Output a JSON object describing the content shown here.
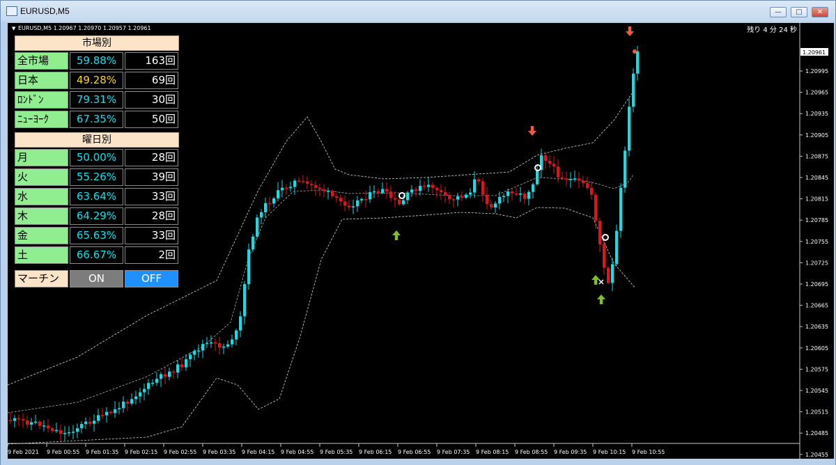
{
  "window": {
    "title": "EURUSD,M5"
  },
  "chart": {
    "info": "EURUSD,M5  1.20967 1.20970 1.20957 1.20961",
    "remaining": "残り 4 分 24 秒",
    "current_price": "1.20961",
    "price_labels": [
      "1.20995",
      "1.20965",
      "1.20935",
      "1.20905",
      "1.20875",
      "1.20845",
      "1.20815",
      "1.20785",
      "1.20755",
      "1.20725",
      "1.20695",
      "1.20665",
      "1.20635",
      "1.20605",
      "1.20575",
      "1.20545",
      "1.20515",
      "1.20485",
      "1.20455"
    ],
    "time_labels": [
      "9 Feb 2021",
      "9 Feb 00:55",
      "9 Feb 01:35",
      "9 Feb 02:15",
      "9 Feb 02:55",
      "9 Feb 03:35",
      "9 Feb 04:15",
      "9 Feb 04:55",
      "9 Feb 05:35",
      "9 Feb 06:15",
      "9 Feb 06:55",
      "9 Feb 07:35",
      "9 Feb 08:15",
      "9 Feb 08:55",
      "9 Feb 09:35",
      "9 Feb 10:15",
      "9 Feb 10:55"
    ],
    "colors": {
      "up": "#00e5ee",
      "down": "#e8101a",
      "band": "#ffffff",
      "arrow_up": "#7fbf2a",
      "arrow_down": "#f05a46",
      "background": "#000000"
    }
  },
  "panel": {
    "market_header": "市場別",
    "market_rows": [
      {
        "name": "全市場",
        "pct": "59.88%",
        "count": "163回",
        "color": "#00e5ee"
      },
      {
        "name": "日本",
        "pct": "49.28%",
        "count": "69回",
        "color": "#ffd700"
      },
      {
        "name": "ﾛﾝﾄﾞﾝ",
        "pct": "79.31%",
        "count": "30回",
        "color": "#00e5ee"
      },
      {
        "name": "ﾆｭｰﾖｰｸ",
        "pct": "67.35%",
        "count": "50回",
        "color": "#00e5ee"
      }
    ],
    "weekday_header": "曜日別",
    "weekday_rows": [
      {
        "name": "月",
        "pct": "50.00%",
        "count": "28回",
        "color": "#00e5ee"
      },
      {
        "name": "火",
        "pct": "55.26%",
        "count": "39回",
        "color": "#00e5ee"
      },
      {
        "name": "水",
        "pct": "63.64%",
        "count": "33回",
        "color": "#00e5ee"
      },
      {
        "name": "木",
        "pct": "64.29%",
        "count": "28回",
        "color": "#00e5ee"
      },
      {
        "name": "金",
        "pct": "65.63%",
        "count": "33回",
        "color": "#00e5ee"
      },
      {
        "name": "土",
        "pct": "66.67%",
        "count": "2回",
        "color": "#00e5ee"
      }
    ],
    "martin": {
      "label": "マーチン",
      "on": "ON",
      "off": "OFF"
    }
  }
}
